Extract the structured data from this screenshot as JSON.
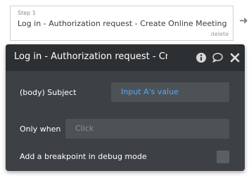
{
  "step": {
    "number_label": "Step 1",
    "title": "Log in - Authorization request - Create Online Meeting",
    "delete_label": "delete"
  },
  "panel": {
    "title": "Log in - Authorization request - Create Online Meeting",
    "icons": [
      "info-icon",
      "comment-icon",
      "close-icon"
    ],
    "fields": {
      "subject_label": "(body) Subject",
      "subject_value": "Input A's value",
      "only_when_label": "Only when",
      "only_when_placeholder": "Click",
      "breakpoint_label": "Add a breakpoint in debug mode"
    }
  },
  "colors": {
    "panel_bg": "#3d4145",
    "header_bg": "#2d3033",
    "field_bg": "#4d5256",
    "dynamic_value": "#5aa8ee"
  }
}
